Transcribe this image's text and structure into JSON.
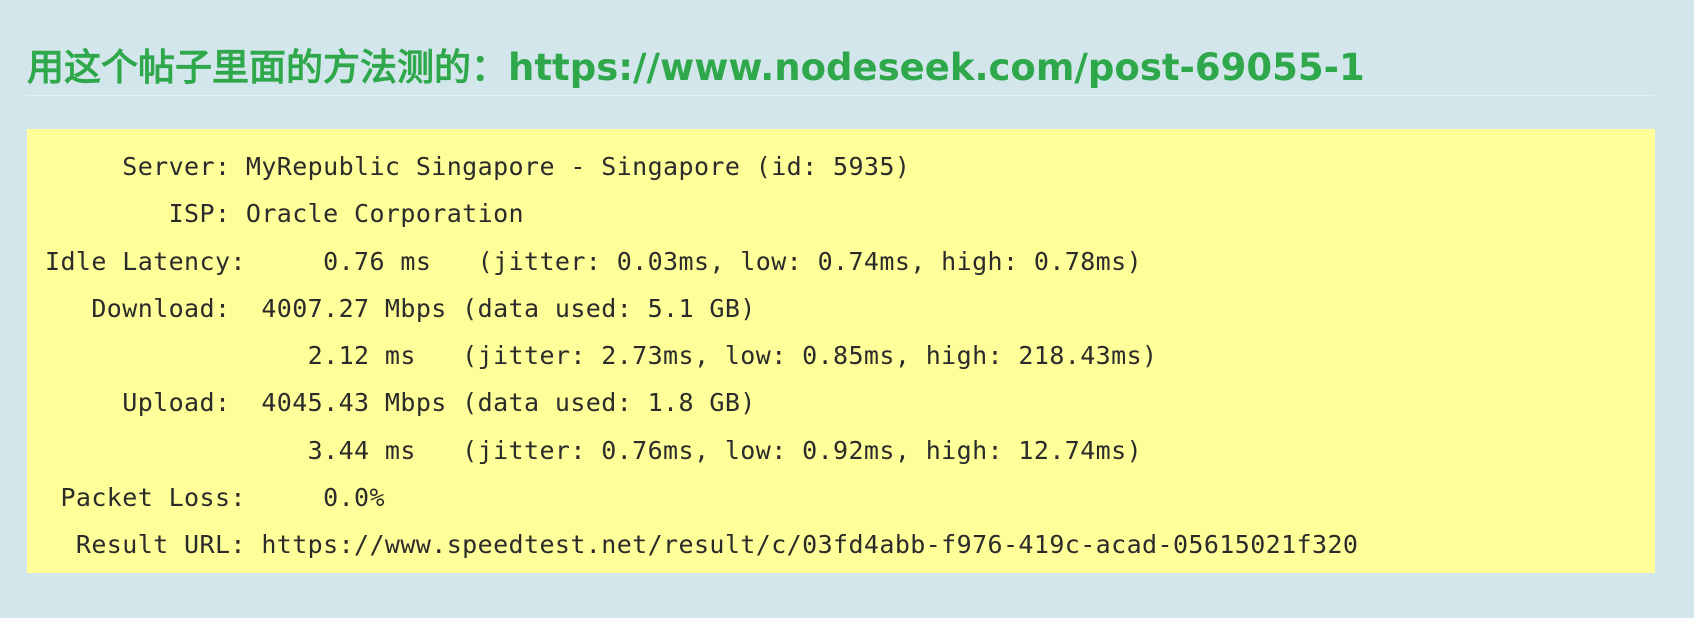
{
  "post": {
    "heading": "用这个帖子里面的方法测的：https://www.nodeseek.com/post-69055-1",
    "colors": {
      "heading": "#2ea84a",
      "page_background": "#d3e6ec",
      "code_background": "#ffff99"
    }
  },
  "speedtest": {
    "lines": [
      "     Server: MyRepublic Singapore - Singapore (id: 5935)",
      "        ISP: Oracle Corporation",
      "Idle Latency:     0.76 ms   (jitter: 0.03ms, low: 0.74ms, high: 0.78ms)",
      "   Download:  4007.27 Mbps (data used: 5.1 GB)",
      "                 2.12 ms   (jitter: 2.73ms, low: 0.85ms, high: 218.43ms)",
      "     Upload:  4045.43 Mbps (data used: 1.8 GB)",
      "                 3.44 ms   (jitter: 0.76ms, low: 0.92ms, high: 12.74ms)",
      " Packet Loss:     0.0%",
      "  Result URL: https://www.speedtest.net/result/c/03fd4abb-f976-419c-acad-05615021f320"
    ]
  }
}
